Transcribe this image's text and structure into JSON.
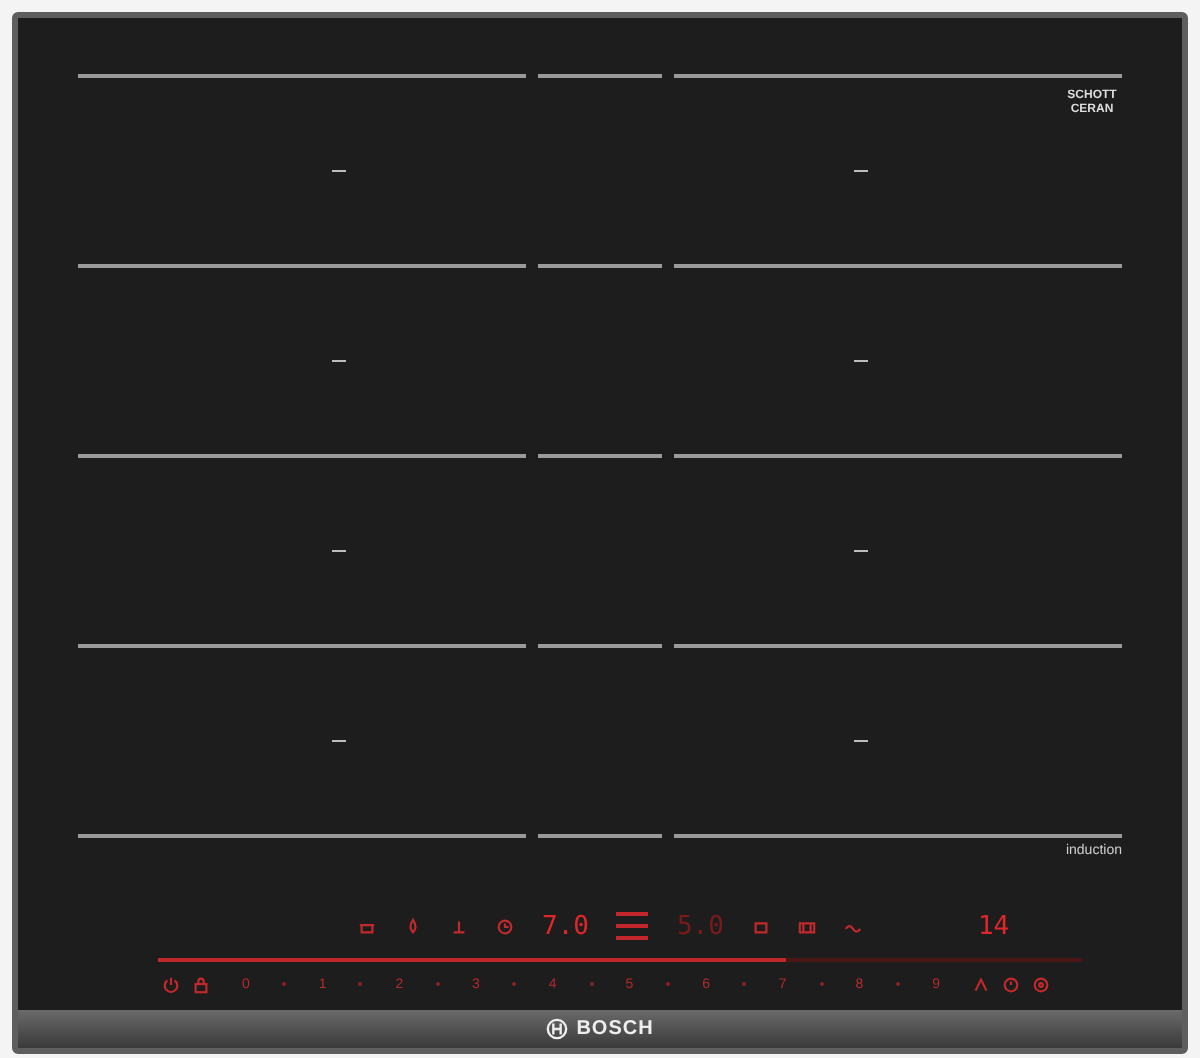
{
  "glass_logo": "SCHOTT CERAN",
  "zone_label": "induction",
  "displays": [
    {
      "kind": "main",
      "text": "7.0"
    },
    {
      "kind": "dim",
      "text": "5.0"
    },
    {
      "kind": "timer",
      "text": "14"
    }
  ],
  "scale": [
    "0",
    "1",
    "2",
    "3",
    "4",
    "5",
    "6",
    "7",
    "8",
    "9"
  ],
  "slider": {
    "level": 0.68
  },
  "brand": "BOSCH"
}
